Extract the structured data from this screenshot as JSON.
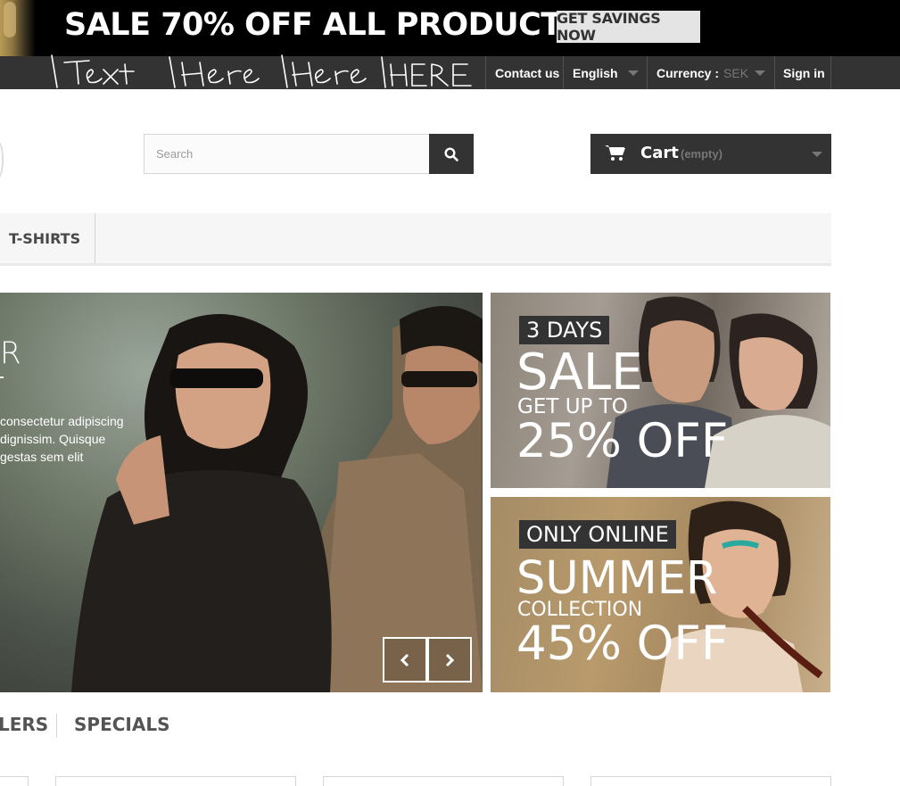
{
  "promo": {
    "title": "SALE 70% OFF ALL PRODUCTS",
    "button_label": "GET SAVINGS NOW"
  },
  "navbar": {
    "scribble_text": "Text Here Here HERE",
    "contact_label": "Contact us",
    "language": "English",
    "currency_label": "Currency :",
    "currency_value": "SEK",
    "signin_label": "Sign in"
  },
  "header": {
    "search_placeholder": "Search",
    "cart_label": "Cart",
    "cart_status": "(empty)"
  },
  "menu": {
    "items": [
      {
        "label": "T-SHIRTS"
      }
    ]
  },
  "slider": {
    "title": "R",
    "text_lines": [
      "consectetur adipiscing",
      "dignissim. Quisque",
      "gestas sem elit"
    ]
  },
  "tiles": [
    {
      "badge": "3 DAYS",
      "big": "SALE",
      "small": "GET UP TO",
      "offer": "25% OFF"
    },
    {
      "badge": "ONLY ONLINE",
      "big": "SUMMER",
      "small": "COLLECTION",
      "offer": "45% OFF"
    }
  ],
  "tabs": [
    {
      "label": "LERS"
    },
    {
      "label": "SPECIALS"
    }
  ],
  "colors": {
    "dark": "#333333",
    "promo_bg": "#000000",
    "menu_bg": "#f6f6f6"
  }
}
